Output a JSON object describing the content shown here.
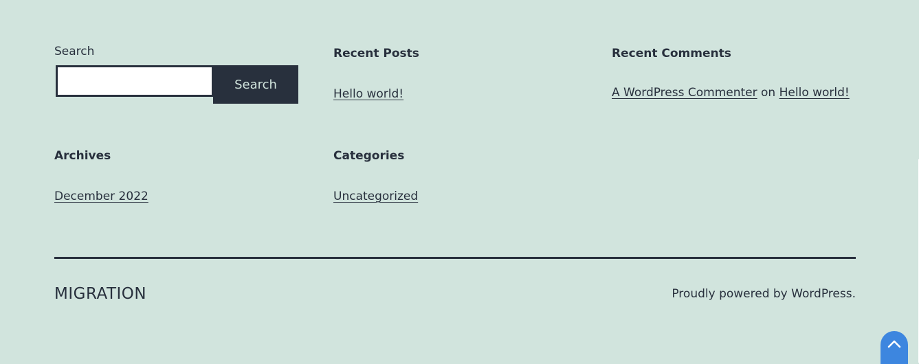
{
  "widgets": {
    "search": {
      "label": "Search",
      "placeholder": "",
      "value": "",
      "button_label": "Search"
    },
    "recent_posts": {
      "title": "Recent Posts",
      "items": [
        "Hello world!"
      ]
    },
    "recent_comments": {
      "title": "Recent Comments",
      "author": "A WordPress Commenter",
      "connector": "on",
      "post": "Hello world!"
    },
    "archives": {
      "title": "Archives",
      "items": [
        "December 2022"
      ]
    },
    "categories": {
      "title": "Categories",
      "items": [
        "Uncategorized"
      ]
    }
  },
  "footer": {
    "site_name": "MIGRATION",
    "powered_by": "Proudly powered by WordPress."
  },
  "scroll_top": {
    "icon": "chevron-up-icon"
  },
  "colors": {
    "background": "#d1e4dd",
    "text": "#28303d",
    "button_bg": "#28303d",
    "button_text": "#d1e4dd",
    "scroll_button": "#3d86df"
  }
}
